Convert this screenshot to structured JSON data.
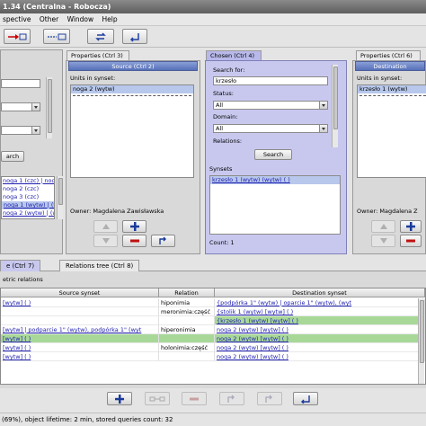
{
  "window": {
    "title": "1.34 (Centralna - Robocza)"
  },
  "menu": [
    "spective",
    "Other",
    "Window",
    "Help"
  ],
  "toolbar": {
    "icons": [
      "arrow-right-box-icon",
      "arrow-box-icon",
      "sync-icon",
      "undo-icon"
    ]
  },
  "left_panel": {
    "list_items": [
      "noga 1 (czc) | noga",
      "noga 2 (czc)",
      "noga 3 (czc)",
      "noga 1 (wytw) | (wytw)",
      "noga 2 (wytw) | (wytw)"
    ],
    "search_label": "arch",
    "selected_row": "noga 1 (wytw) | (wytw)"
  },
  "source_panel": {
    "tab": "Properties (Ctrl 3)",
    "header": "Source (Ctrl 2)",
    "units_label": "Units in synset:",
    "units": [
      "noga 2 (wytw)"
    ],
    "owner": "Owner: Magdalena Zawisławska"
  },
  "chosen_panel": {
    "tab": "Chosen (Ctrl 4)",
    "search_for_label": "Search for:",
    "search_value": "krzesło",
    "status_label": "Status:",
    "status_value": "All",
    "domain_label": "Domain:",
    "domain_value": "All",
    "relations_label": "Relations:",
    "search_button": "Search",
    "synsets_label": "Synsets",
    "synsets": [
      "krzesło 1 (wytw) (wytw) ( )"
    ],
    "count": "Count: 1"
  },
  "dest_panel": {
    "tab": "Properties (Ctrl 6)",
    "header": "Destination",
    "units_label": "Units in synset:",
    "units": [
      "krzesło 1 (wytw)"
    ],
    "owner": "Owner: Magdalena Z"
  },
  "bottom_tabs": [
    "e (Ctrl 7)",
    "Relations tree (Ctrl 8)"
  ],
  "relations_title": "etric relations",
  "table": {
    "headers": [
      "Source synset",
      "Relation",
      "Destination synset"
    ],
    "rows": [
      {
        "source": "[wytw] ( )",
        "relation": "hiponimia",
        "dest": "{podpórka 1\" (wytw) | oparcie 1\" (wytw), (wyt",
        "hl": false
      },
      {
        "source": "",
        "relation": "meronimia:część",
        "dest": "{stolik 1 (wytw) [wytw] ( )",
        "hl": false
      },
      {
        "source": "",
        "relation": "",
        "dest": "{krzesło 1 (wytw) [wytw] ( )",
        "hl": true
      },
      {
        "source": "[wytw] | podparcie 1\" (wytw), podpórka 1\" (wyt",
        "relation": "hiperonimia",
        "dest": "noga 2 (wytw) [wytw] ( )",
        "hl": false
      },
      {
        "source": "[wytw] ( )",
        "relation": "",
        "dest": "noga 2 (wytw) [wytw] ( )",
        "hl": true
      },
      {
        "source": "[wytw] ( )",
        "relation": "holonimia:część",
        "dest": "noga 2 (wytw) [wytw] ( )",
        "hl": false
      },
      {
        "source": "[wytw] ( )",
        "relation": "",
        "dest": "noga 2 (wytw) [wytw] ( )",
        "hl": false
      }
    ]
  },
  "status_bar": "(69%), object lifetime: 2 min, stored queries count: 32"
}
